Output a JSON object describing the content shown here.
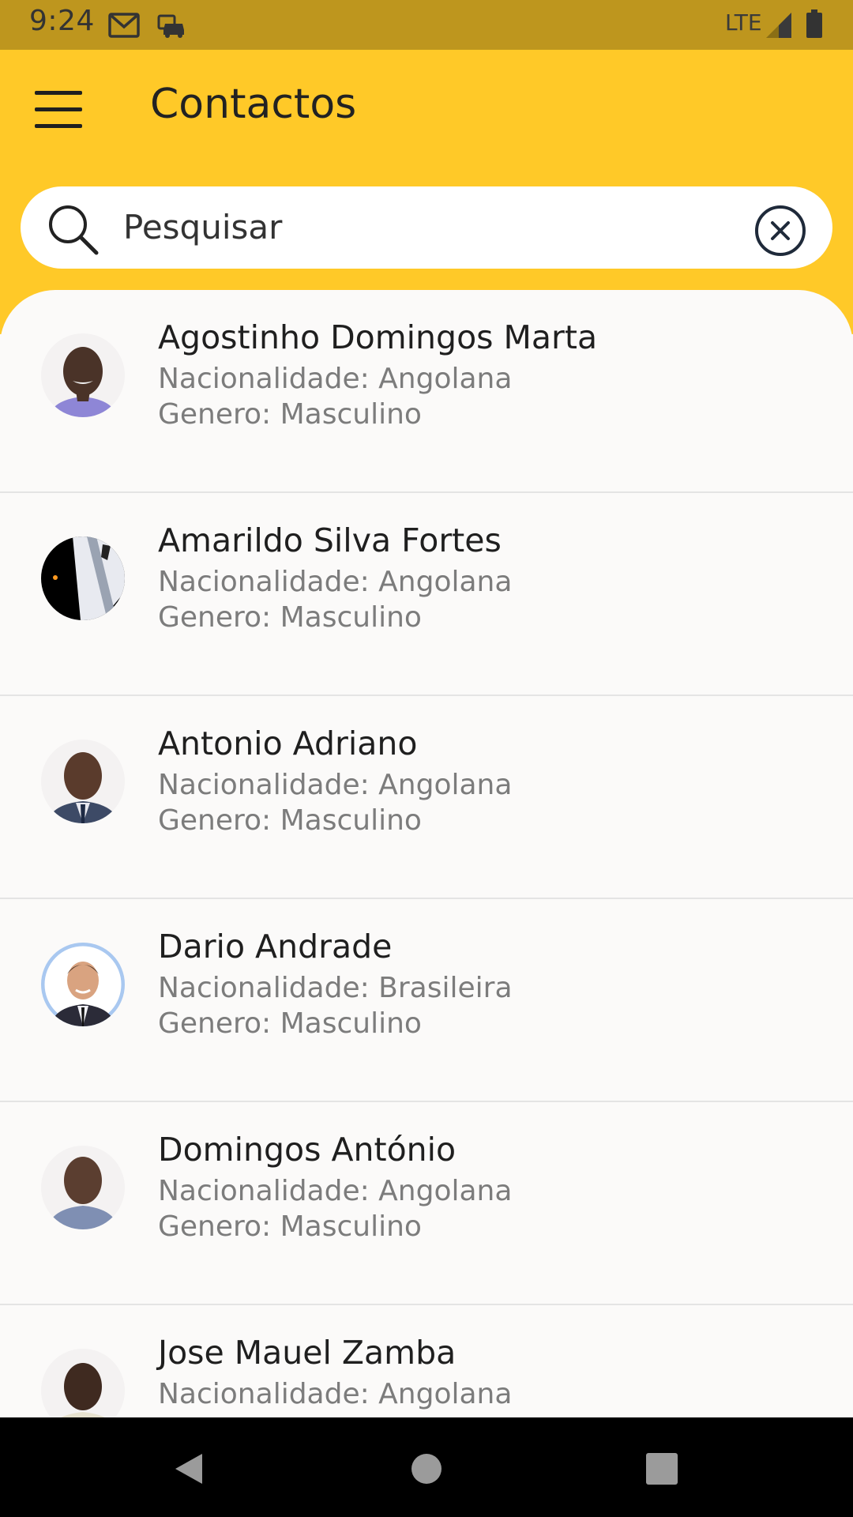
{
  "status_bar": {
    "time": "9:24",
    "network": "LTE",
    "icons": [
      "gmail-icon",
      "car-notification-icon",
      "signal-icon",
      "battery-icon"
    ]
  },
  "header": {
    "title": "Contactos",
    "background_color": "#FFC928",
    "status_bar_color": "#BE961E"
  },
  "search": {
    "placeholder": "Pesquisar",
    "value": ""
  },
  "contacts": [
    {
      "name": "Agostinho Domingos Marta",
      "nationality": "Nacionalidade: Angolana",
      "gender": "Genero: Masculino",
      "avatar": "person-photo"
    },
    {
      "name": "Amarildo Silva Fortes",
      "nationality": "Nacionalidade: Angolana",
      "gender": "Genero: Masculino",
      "avatar": "abstract-photo"
    },
    {
      "name": "Antonio Adriano",
      "nationality": "Nacionalidade: Angolana",
      "gender": "Genero: Masculino",
      "avatar": "person-photo"
    },
    {
      "name": "Dario Andrade",
      "nationality": "Nacionalidade: Brasileira",
      "gender": "Genero: Masculino",
      "avatar": "person-photo"
    },
    {
      "name": "Domingos António",
      "nationality": "Nacionalidade: Angolana",
      "gender": "Genero: Masculino",
      "avatar": "person-photo"
    },
    {
      "name": "Jose Mauel Zamba",
      "nationality": "Nacionalidade: Angolana",
      "gender": "",
      "avatar": "person-photo"
    }
  ],
  "nav_bar": {
    "icons": [
      "back-icon",
      "home-icon",
      "recents-icon"
    ]
  }
}
